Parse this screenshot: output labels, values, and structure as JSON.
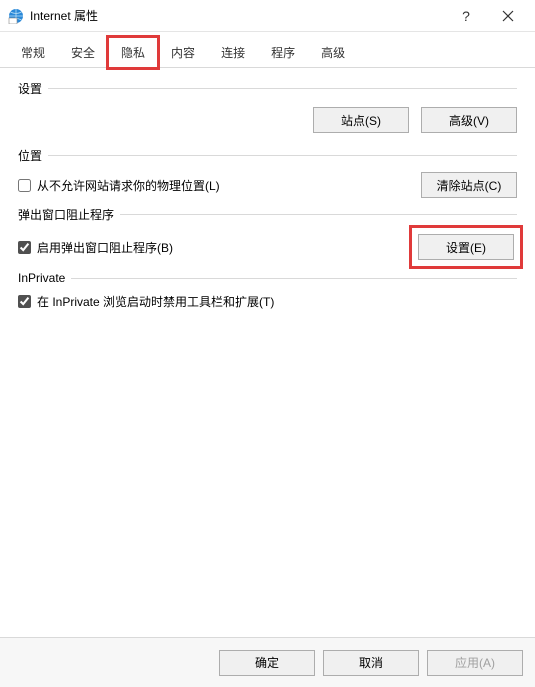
{
  "titlebar": {
    "title": "Internet 属性",
    "help": "?",
    "close": "×"
  },
  "tabs": {
    "items": [
      "常规",
      "安全",
      "隐私",
      "内容",
      "连接",
      "程序",
      "高级"
    ],
    "active_index": 2
  },
  "sections": {
    "settings_label": "设置",
    "sites_btn": "站点(S)",
    "advanced_btn": "高级(V)",
    "location_label": "位置",
    "location_checkbox": "从不允许网站请求你的物理位置(L)",
    "location_checked": false,
    "clear_sites_btn": "清除站点(C)",
    "popup_label": "弹出窗口阻止程序",
    "popup_checkbox": "启用弹出窗口阻止程序(B)",
    "popup_checked": true,
    "popup_settings_btn": "设置(E)",
    "inprivate_label": "InPrivate",
    "inprivate_checkbox": "在 InPrivate 浏览启动时禁用工具栏和扩展(T)",
    "inprivate_checked": true
  },
  "footer": {
    "ok": "确定",
    "cancel": "取消",
    "apply": "应用(A)"
  }
}
